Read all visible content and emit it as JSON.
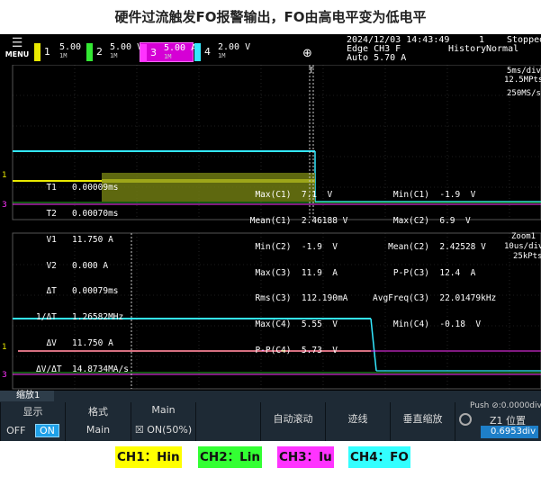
{
  "title": "硬件过流触发FO报警输出，FO由高电平变为低电平",
  "menu_label": "MENU",
  "channels": [
    {
      "num": "1",
      "volt": "5.00 V",
      "bw": "1M",
      "color": "#e8e800"
    },
    {
      "num": "2",
      "volt": "5.00 V",
      "bw": "1M",
      "color": "#33e833"
    },
    {
      "num": "3",
      "volt": "5.00 A",
      "bw": "1M",
      "color": "#ff33ff"
    },
    {
      "num": "4",
      "volt": "2.00 V",
      "bw": "1M",
      "color": "#33e8ff"
    }
  ],
  "header": {
    "datetime": "2024/12/03  14:43:49",
    "trigger": "Edge  CH3  F",
    "trigger_level": "Auto  5.70 A",
    "count": "1",
    "state": "Stopped",
    "mode_label": "History",
    "mode": "Normal",
    "time_div": "5ms/div",
    "points": "12.5MPts",
    "sample": "250MS/s"
  },
  "measurements_left": [
    "  T1   0.00009ms",
    "  T2   0.00070ms",
    "  V1   11.750 A",
    "  V2   0.000 A",
    "  ΔT   0.00079ms",
    "1/ΔT   1.26582MHz",
    "  ΔV   11.750 A",
    "ΔV/ΔT  14.8734MA/s"
  ],
  "measurements_mid": [
    "  Max(C1)  7.1  V",
    " Mean(C1)  2.46188 V",
    "  Min(C2)  -1.9  V",
    "  Max(C3)  11.9  A",
    "  Rms(C3)  112.190mA",
    "  Max(C4)  5.55  V",
    "  P-P(C4)  5.73  V"
  ],
  "measurements_right": [
    "    Min(C1)  -1.9  V",
    "    Max(C2)  6.9  V",
    "   Mean(C2)  2.42528 V",
    "    P-P(C3)  12.4  A",
    "AvgFreq(C3)  22.01479kHz",
    "    Min(C4)  -0.18  V"
  ],
  "zoom": {
    "label": "Zoom1",
    "time_div": "10us/div",
    "points": "25kPts"
  },
  "softkeys": {
    "tab": "缩放1",
    "display_label": "显示",
    "off": "OFF",
    "on": "ON",
    "format_label": "格式",
    "format_value": "Main",
    "main_label": "Main",
    "main_value": "ON(50%)",
    "autoscroll": "自动滚动",
    "trace": "迹线",
    "vzoom": "垂直缩放",
    "push_label": "Push ⊘:0.0000div",
    "z1_label": "Z1 位置",
    "z1_value": "0.6953div"
  },
  "legend": [
    {
      "text": "CH1：Hin",
      "bg": "#ffff00",
      "fg": "#111111"
    },
    {
      "text": "CH2：Lin",
      "bg": "#33ff33",
      "fg": "#111111"
    },
    {
      "text": "CH3：Iu",
      "bg": "#ff33ff",
      "fg": "#111111"
    },
    {
      "text": "CH4：FO",
      "bg": "#33ffff",
      "fg": "#111111"
    }
  ]
}
